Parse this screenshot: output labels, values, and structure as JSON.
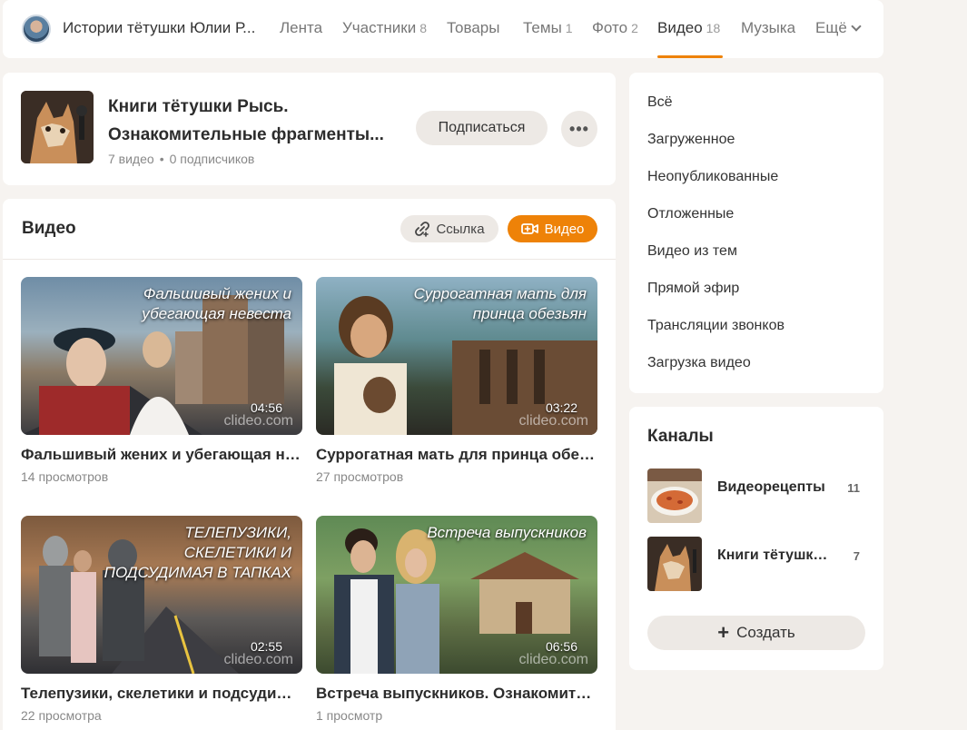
{
  "nav": {
    "group_title": "Истории тётушки Юлии Р...",
    "tabs": [
      {
        "label": "Лента",
        "count": ""
      },
      {
        "label": "Участники",
        "count": "8"
      },
      {
        "label": "Товары",
        "count": ""
      },
      {
        "label": "Темы",
        "count": "1"
      },
      {
        "label": "Фото",
        "count": "2"
      },
      {
        "label": "Видео",
        "count": "18"
      },
      {
        "label": "Музыка",
        "count": ""
      },
      {
        "label": "Ещё",
        "count": ""
      }
    ],
    "active_tab": "Видео",
    "accent_color": "#ee8208"
  },
  "album": {
    "title": "Книги тётушки Рысь. Ознакомительные фрагменты...",
    "video_count": "7 видео",
    "subscriber_count": "0 подписчиков",
    "subscribe_label": "Подписаться",
    "more_label": "•••"
  },
  "video_section": {
    "title": "Видео",
    "link_label": "Ссылка",
    "add_label": "Видео",
    "videos": [
      {
        "title": "Фальшивый жених и убегающая невеста",
        "views": "14 просмотров",
        "duration": "04:56",
        "overlay": "Фальшивый жених и убегающая невеста",
        "watermark": "clideo.com"
      },
      {
        "title": "Суррогатная мать для принца обезьян",
        "views": "27 просмотров",
        "duration": "03:22",
        "overlay": "Суррогатная мать для принца обезьян",
        "watermark": "clideo.com"
      },
      {
        "title": "Телепузики, скелетики и подсудимая в тапках",
        "views": "22 просмотра",
        "duration": "02:55",
        "overlay": "ТЕЛЕПУЗИКИ, СКЕЛЕТИКИ И ПОДСУДИМАЯ В ТАПКАХ",
        "watermark": "clideo.com"
      },
      {
        "title": "Встреча выпускников. Ознакомительный фрагмент",
        "views": "1 просмотр",
        "duration": "06:56",
        "overlay": "Встреча выпускников",
        "watermark": "clideo.com"
      }
    ]
  },
  "filters": {
    "items": [
      "Всё",
      "Загруженное",
      "Неопубликованные",
      "Отложенные",
      "Видео из тем",
      "Прямой эфир",
      "Трансляции звонков",
      "Загрузка видео"
    ]
  },
  "channels": {
    "title": "Каналы",
    "items": [
      {
        "name": "Видеорецепты",
        "count": "11"
      },
      {
        "name": "Книги тётушки Рысь",
        "count": "7"
      }
    ],
    "create_label": "Создать"
  }
}
